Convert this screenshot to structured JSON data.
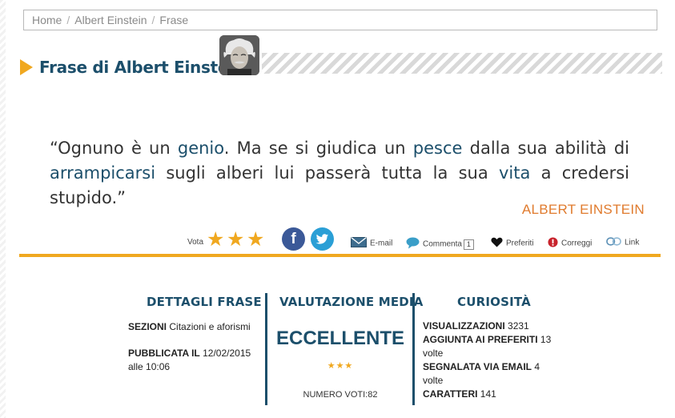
{
  "breadcrumb": {
    "home": "Home",
    "author": "Albert Einstein",
    "current": "Frase"
  },
  "header": {
    "title": "Frase di Albert Einstein"
  },
  "quote": {
    "open": "“",
    "p1": "Ognuno è un ",
    "k1": "genio",
    "p2": ". Ma se si giudica un ",
    "k2": "pesce",
    "p3": " dalla sua abilità di ",
    "k3": "arrampicarsi",
    "p4": " sugli alberi lui passerà tutta la sua ",
    "k4": "vita",
    "p5": " a credersi stupido.",
    "close": "”",
    "author": "ALBERT EINSTEIN"
  },
  "actions": {
    "vota_label": "Vota",
    "rating_stars": 3,
    "facebook_glyph": "f",
    "email": "E-mail",
    "comment": "Commenta",
    "comment_count": "1",
    "favorites": "Preferiti",
    "correct": "Correggi",
    "link": "Link"
  },
  "details": {
    "heading": "DETTAGLI FRASE",
    "sections_label": "SEZIONI",
    "sections_value": "Citazioni e aforismi",
    "published_label": "PUBBLICATA IL",
    "published_value": "12/02/2015",
    "published_time": "alle 10:06"
  },
  "rating": {
    "heading": "VALUTAZIONE MEDIA",
    "verdict": "ECCELLENTE",
    "stars": "★★★",
    "votes": "NUMERO VOTI:82"
  },
  "curiosity": {
    "heading": "CURIOSITÀ",
    "views_label": "VISUALIZZAZIONI",
    "views_value": "3231",
    "favorites_label": "AGGIUNTA AI PREFERITI",
    "favorites_value": "13",
    "favorites_suffix": "volte",
    "email_label": "SEGNALATA VIA EMAIL",
    "email_value": "4",
    "email_suffix": "volte",
    "chars_label": "CARATTERI",
    "chars_value": "141"
  },
  "colors": {
    "accent": "#f0a820",
    "primary": "#1c4f6b",
    "author": "#e07b2e"
  }
}
